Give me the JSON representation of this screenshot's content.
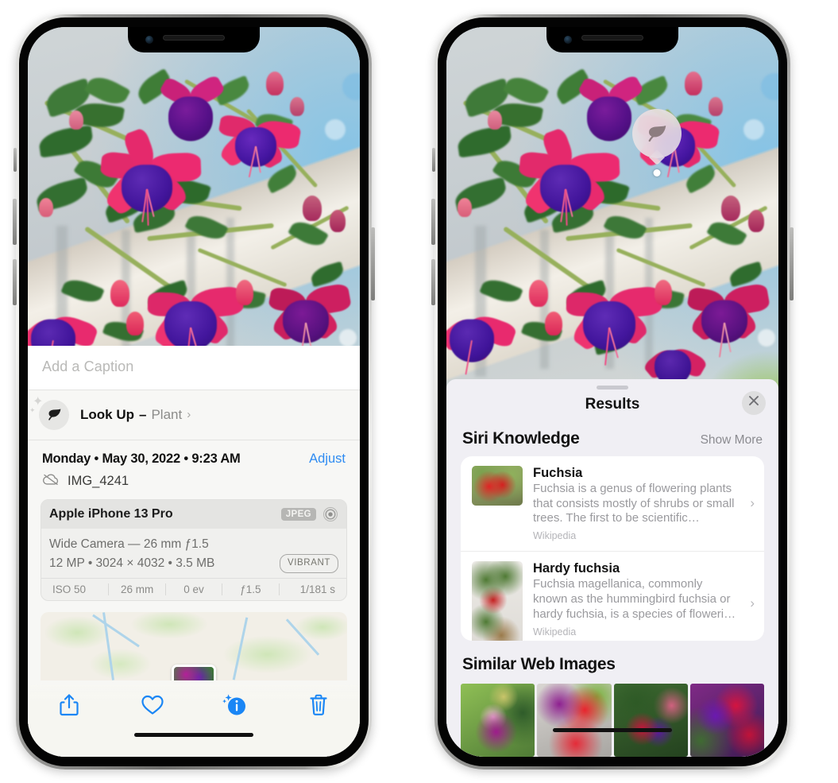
{
  "left_phone": {
    "caption": {
      "placeholder": "Add a Caption",
      "value": ""
    },
    "lookup": {
      "icon": "leaf-icon",
      "sparkle_icon": "sparkles-icon",
      "label": "Look Up",
      "dash": "–",
      "subject": "Plant",
      "chevron": "›"
    },
    "meta": {
      "date": "Monday • May 30, 2022 • 9:23 AM",
      "adjust_label": "Adjust",
      "cloud_icon": "cloud-slash-icon",
      "file_name": "IMG_4241"
    },
    "camera": {
      "model": "Apple iPhone 13 Pro",
      "format_badge": "JPEG",
      "lens_icon": "aperture-icon",
      "lens_line": "Wide Camera — 26 mm ƒ1.5",
      "specs_line": "12 MP • 3024 × 4032 • 3.5 MB",
      "style_badge": "VIBRANT",
      "exif": [
        "ISO 50",
        "26 mm",
        "0 ev",
        "ƒ1.5",
        "1/181 s"
      ]
    },
    "toolbar": [
      {
        "name": "share-icon",
        "label": "Share"
      },
      {
        "name": "heart-icon",
        "label": "Favorite"
      },
      {
        "name": "info-sparkle-icon",
        "label": "Info"
      },
      {
        "name": "trash-icon",
        "label": "Delete"
      }
    ]
  },
  "right_phone": {
    "photo_badge": {
      "icon": "leaf-icon",
      "label": "Plant lookup"
    },
    "sheet": {
      "grabber": "",
      "title": "Results",
      "close_icon": "close-icon"
    },
    "siri_knowledge": {
      "title": "Siri Knowledge",
      "action": "Show More",
      "items": [
        {
          "name": "Fuchsia",
          "description": "Fuchsia is a genus of flowering plants that consists mostly of shrubs or small trees. The first to be scientific…",
          "source": "Wikipedia",
          "chevron": "›"
        },
        {
          "name": "Hardy fuchsia",
          "description": "Fuchsia magellanica, commonly known as the hummingbird fuchsia or hardy fuchsia, is a species of floweri…",
          "source": "Wikipedia",
          "chevron": "›"
        }
      ]
    },
    "similar_web_images": {
      "title": "Similar Web Images",
      "count": 4
    }
  },
  "colors": {
    "accent_blue": "#2e8bf2",
    "sheet_bg": "#f0eff4",
    "card_white": "#ffffff",
    "secondary_text": "#9a9a9e"
  }
}
